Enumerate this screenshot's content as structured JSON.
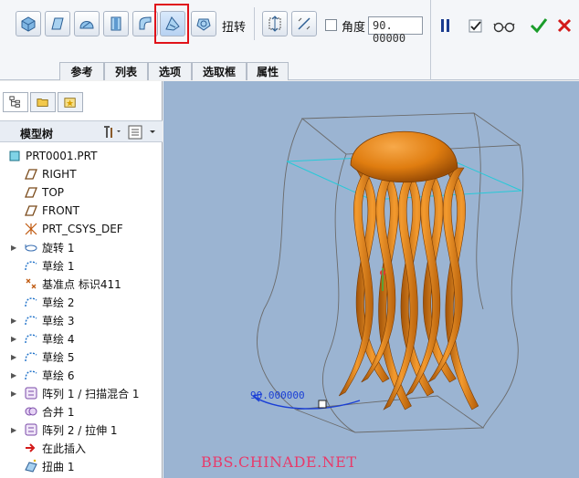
{
  "toolbar": {
    "twist_label": "扭转",
    "angle_label": "角度",
    "angle_value": "90. 00000",
    "tools": [
      {
        "name": "solid-icon"
      },
      {
        "name": "surface-icon"
      },
      {
        "name": "remove-material-icon"
      },
      {
        "name": "thicken-icon"
      },
      {
        "name": "sweep-icon"
      },
      {
        "name": "twist-icon"
      },
      {
        "name": "rotate-icon"
      }
    ],
    "tabs": [
      "参考",
      "列表",
      "选项",
      "选取框",
      "属性"
    ],
    "colors": {
      "highlight": "#e0121a",
      "ok": "#1a9c2a",
      "cancel": "#d31a1a",
      "pause": "#1b3c8f"
    }
  },
  "model_tree": {
    "title": "模型树",
    "items": [
      {
        "label": "PRT0001.PRT",
        "icon": "part-icon",
        "expandable": false
      },
      {
        "label": "RIGHT",
        "icon": "datum-plane-icon",
        "expandable": false
      },
      {
        "label": "TOP",
        "icon": "datum-plane-icon",
        "expandable": false
      },
      {
        "label": "FRONT",
        "icon": "datum-plane-icon",
        "expandable": false
      },
      {
        "label": "PRT_CSYS_DEF",
        "icon": "csys-icon",
        "expandable": false
      },
      {
        "label": "旋转 1",
        "icon": "revolve-icon",
        "expandable": true
      },
      {
        "label": "草绘 1",
        "icon": "sketch-icon",
        "expandable": false
      },
      {
        "label": "基准点 标识411",
        "icon": "datum-point-icon",
        "expandable": false
      },
      {
        "label": "草绘 2",
        "icon": "sketch-icon",
        "expandable": false
      },
      {
        "label": "草绘 3",
        "icon": "sketch-icon",
        "expandable": true
      },
      {
        "label": "草绘 4",
        "icon": "sketch-icon",
        "expandable": true
      },
      {
        "label": "草绘 5",
        "icon": "sketch-icon",
        "expandable": true
      },
      {
        "label": "草绘 6",
        "icon": "sketch-icon",
        "expandable": true
      },
      {
        "label": "阵列 1 / 扫描混合 1",
        "icon": "pattern-icon",
        "expandable": true
      },
      {
        "label": "合并 1",
        "icon": "merge-icon",
        "expandable": false
      },
      {
        "label": "阵列 2 / 拉伸 1",
        "icon": "pattern-icon",
        "expandable": true
      },
      {
        "label": "在此插入",
        "icon": "insert-arrow-icon",
        "expandable": false
      },
      {
        "label": "扭曲 1",
        "icon": "warp-icon",
        "expandable": false
      }
    ]
  },
  "viewport": {
    "dimension_label": "90.000000",
    "watermark": "BBS.CHINADE.NET",
    "colors": {
      "background": "#9bb4d2",
      "model": "#e07d10",
      "dimension": "#1a3fd6",
      "plane": "#27c9d8"
    }
  }
}
